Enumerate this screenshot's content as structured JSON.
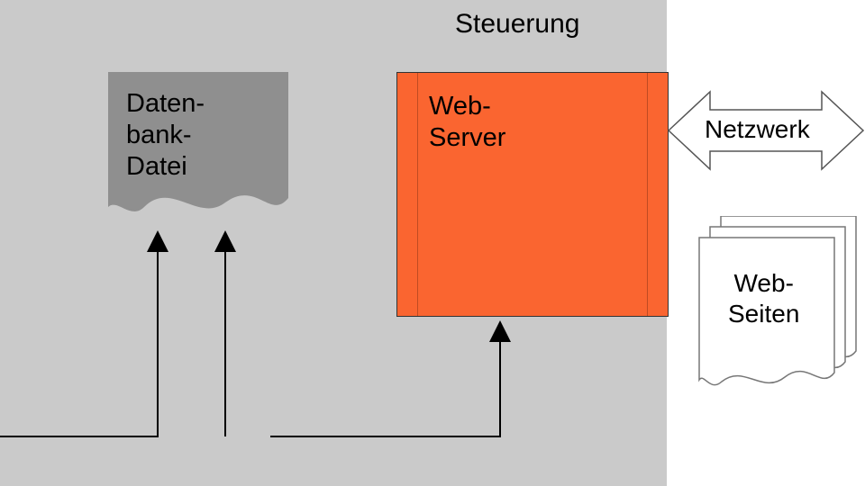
{
  "control": {
    "label": "Steuerung"
  },
  "database": {
    "lines": "Daten-\nbank-\nDatei"
  },
  "webServer": {
    "lines": "Web-\nServer"
  },
  "network": {
    "label": "Netzwerk"
  },
  "webPages": {
    "lines": "Web-\nSeiten"
  },
  "colors": {
    "panel": "#cacaca",
    "dbFill": "#8f8f8f",
    "serverFill": "#fa6530"
  }
}
